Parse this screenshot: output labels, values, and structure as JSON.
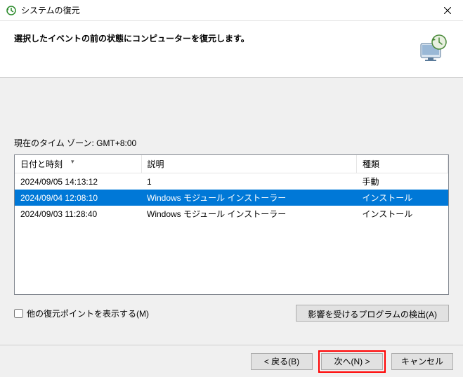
{
  "window": {
    "title": "システムの復元"
  },
  "header": {
    "text": "選択したイベントの前の状態にコンピューターを復元します。"
  },
  "timezone": {
    "label": "現在のタイム ゾーン: GMT+8:00"
  },
  "table": {
    "columns": {
      "date": "日付と時刻",
      "desc": "説明",
      "type": "種類"
    },
    "rows": [
      {
        "date": "2024/09/05 14:13:12",
        "desc": "1",
        "type": "手動",
        "selected": false
      },
      {
        "date": "2024/09/04 12:08:10",
        "desc": "Windows モジュール インストーラー",
        "type": "インストール",
        "selected": true
      },
      {
        "date": "2024/09/03 11:28:40",
        "desc": "Windows モジュール インストーラー",
        "type": "インストール",
        "selected": false
      }
    ]
  },
  "showMore": {
    "label": "他の復元ポイントを表示する(M)"
  },
  "scanButton": {
    "label": "影響を受けるプログラムの検出(A)"
  },
  "footer": {
    "back": "< 戻る(B)",
    "next": "次へ(N) >",
    "cancel": "キャンセル"
  }
}
